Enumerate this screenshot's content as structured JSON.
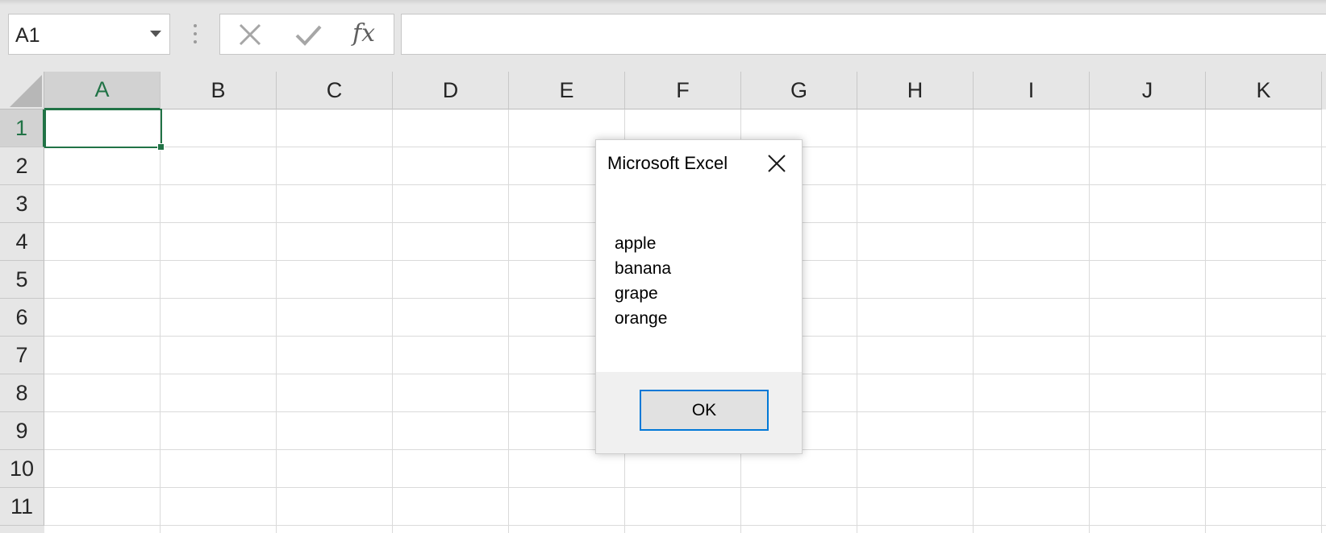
{
  "formula_bar": {
    "name_box": "A1",
    "formula_value": "",
    "icons": [
      "chevron-down-icon",
      "grip-icon",
      "cancel-icon",
      "check-icon",
      "fx-icon"
    ],
    "fx_label": "fx"
  },
  "sheet": {
    "columns": [
      "A",
      "B",
      "C",
      "D",
      "E",
      "F",
      "G",
      "H",
      "I",
      "J",
      "K"
    ],
    "rows": [
      "1",
      "2",
      "3",
      "4",
      "5",
      "6",
      "7",
      "8",
      "9",
      "10",
      "11"
    ],
    "active_column": "A",
    "active_row": "1"
  },
  "dialog": {
    "title": "Microsoft Excel",
    "lines": [
      "apple",
      "banana",
      "grape",
      "orange"
    ],
    "ok_label": "OK",
    "close_icon": "close-icon"
  },
  "colors": {
    "accent": "#217346",
    "button_focus": "#0078d7"
  }
}
